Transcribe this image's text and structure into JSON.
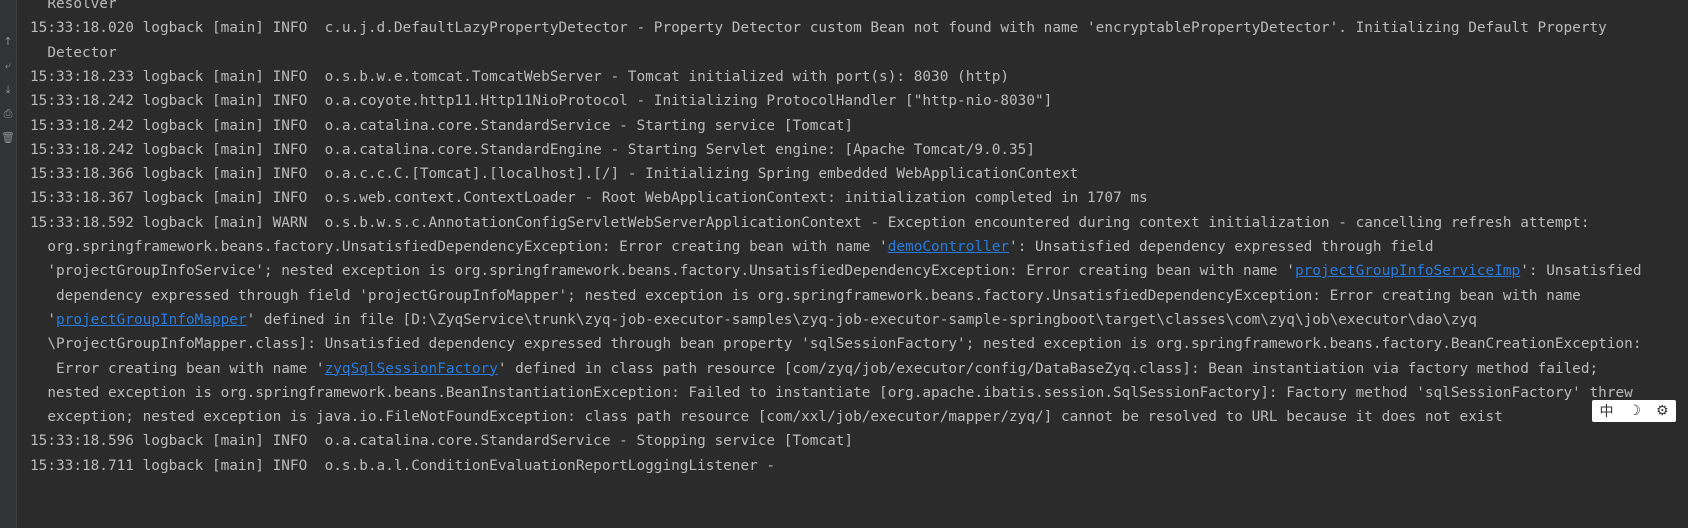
{
  "console": {
    "lines": [
      {
        "text": "  Resolver"
      },
      {
        "text": "15:33:18.020 logback [main] INFO  c.u.j.d.DefaultLazyPropertyDetector - Property Detector custom Bean not found with name 'encryptablePropertyDetector'. Initializing Default Property"
      },
      {
        "text": "  Detector"
      },
      {
        "text": "15:33:18.233 logback [main] INFO  o.s.b.w.e.tomcat.TomcatWebServer - Tomcat initialized with port(s): 8030 (http)"
      },
      {
        "text": "15:33:18.242 logback [main] INFO  o.a.coyote.http11.Http11NioProtocol - Initializing ProtocolHandler [\"http-nio-8030\"]"
      },
      {
        "text": "15:33:18.242 logback [main] INFO  o.a.catalina.core.StandardService - Starting service [Tomcat]"
      },
      {
        "text": "15:33:18.242 logback [main] INFO  o.a.catalina.core.StandardEngine - Starting Servlet engine: [Apache Tomcat/9.0.35]"
      },
      {
        "text": "15:33:18.366 logback [main] INFO  o.a.c.c.C.[Tomcat].[localhost].[/] - Initializing Spring embedded WebApplicationContext"
      },
      {
        "text": "15:33:18.367 logback [main] INFO  o.s.web.context.ContextLoader - Root WebApplicationContext: initialization completed in 1707 ms"
      },
      {
        "text": "15:33:18.592 logback [main] WARN  o.s.b.w.s.c.AnnotationConfigServletWebServerApplicationContext - Exception encountered during context initialization - cancelling refresh attempt:"
      },
      {
        "pre": "  org.springframework.beans.factory.UnsatisfiedDependencyException: Error creating bean with name '",
        "link": "demoController",
        "post": "': Unsatisfied dependency expressed through field"
      },
      {
        "pre": "  'projectGroupInfoService'; nested exception is org.springframework.beans.factory.UnsatisfiedDependencyException: Error creating bean with name '",
        "link": "projectGroupInfoServiceImp",
        "post": "': Unsatisfied"
      },
      {
        "text": "   dependency expressed through field 'projectGroupInfoMapper'; nested exception is org.springframework.beans.factory.UnsatisfiedDependencyException: Error creating bean with name"
      },
      {
        "pre": "  '",
        "link": "projectGroupInfoMapper",
        "post": "' defined in file [D:\\ZyqService\\trunk\\zyq-job-executor-samples\\zyq-job-executor-sample-springboot\\target\\classes\\com\\zyq\\job\\executor\\dao\\zyq"
      },
      {
        "text": "  \\ProjectGroupInfoMapper.class]: Unsatisfied dependency expressed through bean property 'sqlSessionFactory'; nested exception is org.springframework.beans.factory.BeanCreationException:"
      },
      {
        "pre": "   Error creating bean with name '",
        "link": "zyqSqlSessionFactory",
        "post": "' defined in class path resource [com/zyq/job/executor/config/DataBaseZyq.class]: Bean instantiation via factory method failed;"
      },
      {
        "text": "  nested exception is org.springframework.beans.BeanInstantiationException: Failed to instantiate [org.apache.ibatis.session.SqlSessionFactory]: Factory method 'sqlSessionFactory' threw"
      },
      {
        "text": "  exception; nested exception is java.io.FileNotFoundException: class path resource [com/xxl/job/executor/mapper/zyq/] cannot be resolved to URL because it does not exist"
      },
      {
        "text": "15:33:18.596 logback [main] INFO  o.a.catalina.core.StandardService - Stopping service [Tomcat]"
      },
      {
        "text": "15:33:18.711 logback [main] INFO  o.s.b.a.l.ConditionEvaluationReportLoggingListener -"
      }
    ]
  },
  "gutter": {
    "icons": [
      {
        "name": "scroll-up-icon",
        "glyph": "↑"
      },
      {
        "name": "soft-wrap-icon",
        "glyph": "⤶"
      },
      {
        "name": "scroll-to-end-icon",
        "glyph": "⤓"
      },
      {
        "name": "print-icon",
        "glyph": "⎙"
      },
      {
        "name": "clear-all-icon",
        "glyph": "🗑"
      }
    ]
  },
  "ime": {
    "lang_label": "中",
    "moon_glyph": "☽",
    "tools_glyph": "⚙"
  }
}
